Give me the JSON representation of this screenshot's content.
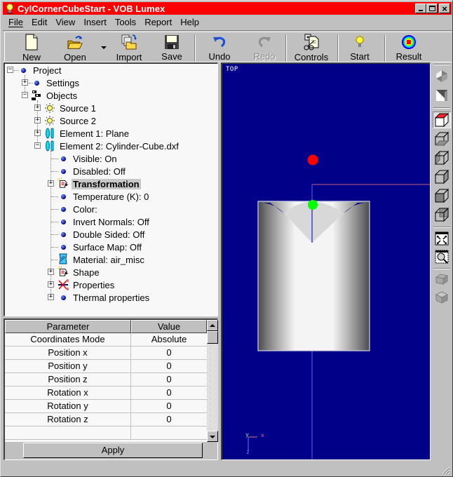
{
  "window": {
    "title": "CylCornerCubeStart - VOB Lumex",
    "title_bar_color": "#ff0000",
    "controls": {
      "minimize": "_",
      "maximize": "□",
      "close": "×"
    }
  },
  "menu": [
    {
      "label": "File",
      "accel": "F"
    },
    {
      "label": "Edit",
      "accel": "E"
    },
    {
      "label": "View",
      "accel": "V"
    },
    {
      "label": "Insert",
      "accel": "I"
    },
    {
      "label": "Tools",
      "accel": "T"
    },
    {
      "label": "Report",
      "accel": "R"
    },
    {
      "label": "Help",
      "accel": "H"
    }
  ],
  "toolbar": {
    "new": {
      "label": "New",
      "icon": "new-document-icon"
    },
    "open": {
      "label": "Open",
      "icon": "open-folder-icon"
    },
    "import": {
      "label": "Import",
      "icon": "import-icon"
    },
    "save": {
      "label": "Save",
      "icon": "floppy-disk-icon"
    },
    "undo": {
      "label": "Undo",
      "icon": "undo-arrow-icon"
    },
    "redo": {
      "label": "Redo",
      "icon": "redo-arrow-icon",
      "disabled": true
    },
    "controls": {
      "label": "Controls",
      "icon": "controls-icon"
    },
    "start": {
      "label": "Start",
      "icon": "lightbulb-icon"
    },
    "result": {
      "label": "Result",
      "icon": "heatmap-result-icon"
    }
  },
  "tree": {
    "project": "Project",
    "settings": "Settings",
    "objects": "Objects",
    "source1": "Source 1",
    "source2": "Source 2",
    "element1": "Element 1: Plane",
    "element2": "Element 2: Cylinder-Cube.dxf",
    "visible": "Visible: On",
    "disabled": "Disabled: Off",
    "transformation": "Transformation",
    "temperature": "Temperature (K): 0",
    "color": "Color:",
    "invert_normals": "Invert Normals: Off",
    "double_sided": "Double Sided: Off",
    "surface_map": "Surface Map: Off",
    "material": "Material: air_misc",
    "shape": "Shape",
    "properties": "Properties",
    "thermal": "Thermal properties",
    "selected": "Transformation"
  },
  "params": {
    "header": {
      "param": "Parameter",
      "value": "Value"
    },
    "rows": [
      {
        "param": "Coordinates Mode",
        "value": "Absolute"
      },
      {
        "param": "Position x",
        "value": "0"
      },
      {
        "param": "Position y",
        "value": "0"
      },
      {
        "param": "Position z",
        "value": "0"
      },
      {
        "param": "Rotation x",
        "value": "0"
      },
      {
        "param": "Rotation y",
        "value": "0"
      },
      {
        "param": "Rotation z",
        "value": "0"
      },
      {
        "param": "",
        "value": ""
      }
    ],
    "apply_label": "Apply"
  },
  "viewport": {
    "view_name": "TOP",
    "background": "#000088",
    "axes": {
      "x": "x",
      "y": "y",
      "z": "z"
    },
    "markers": {
      "source_color": "#ff0000",
      "origin_color": "#00ff00"
    }
  },
  "side_toolbar": [
    "shaded-view-icon",
    "wireframe-view-icon",
    "view-top-icon",
    "view-bottom-icon",
    "view-left-icon",
    "view-right-icon",
    "view-front-icon",
    "zoom-extents-icon",
    "zoom-window-icon",
    "rotate-box-icon",
    "isometric-box-icon"
  ]
}
